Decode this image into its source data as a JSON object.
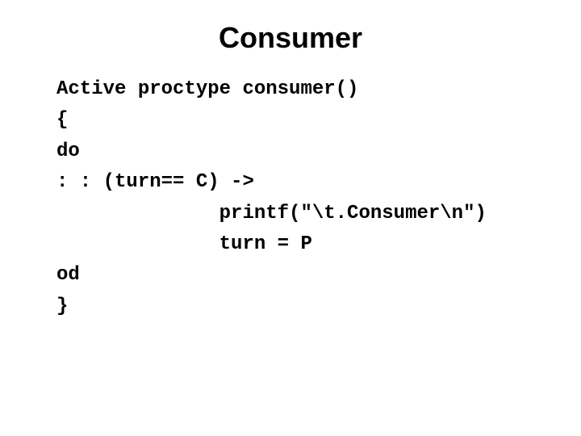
{
  "title": "Consumer",
  "code": {
    "l1": "Active proctype consumer()",
    "l2": "{",
    "l3": "do",
    "l4": ": : (turn== C) ->",
    "l5": "              printf(\"\\t.Consumer\\n\")",
    "l6": "              turn = P",
    "l7": "od",
    "l8": "}"
  }
}
